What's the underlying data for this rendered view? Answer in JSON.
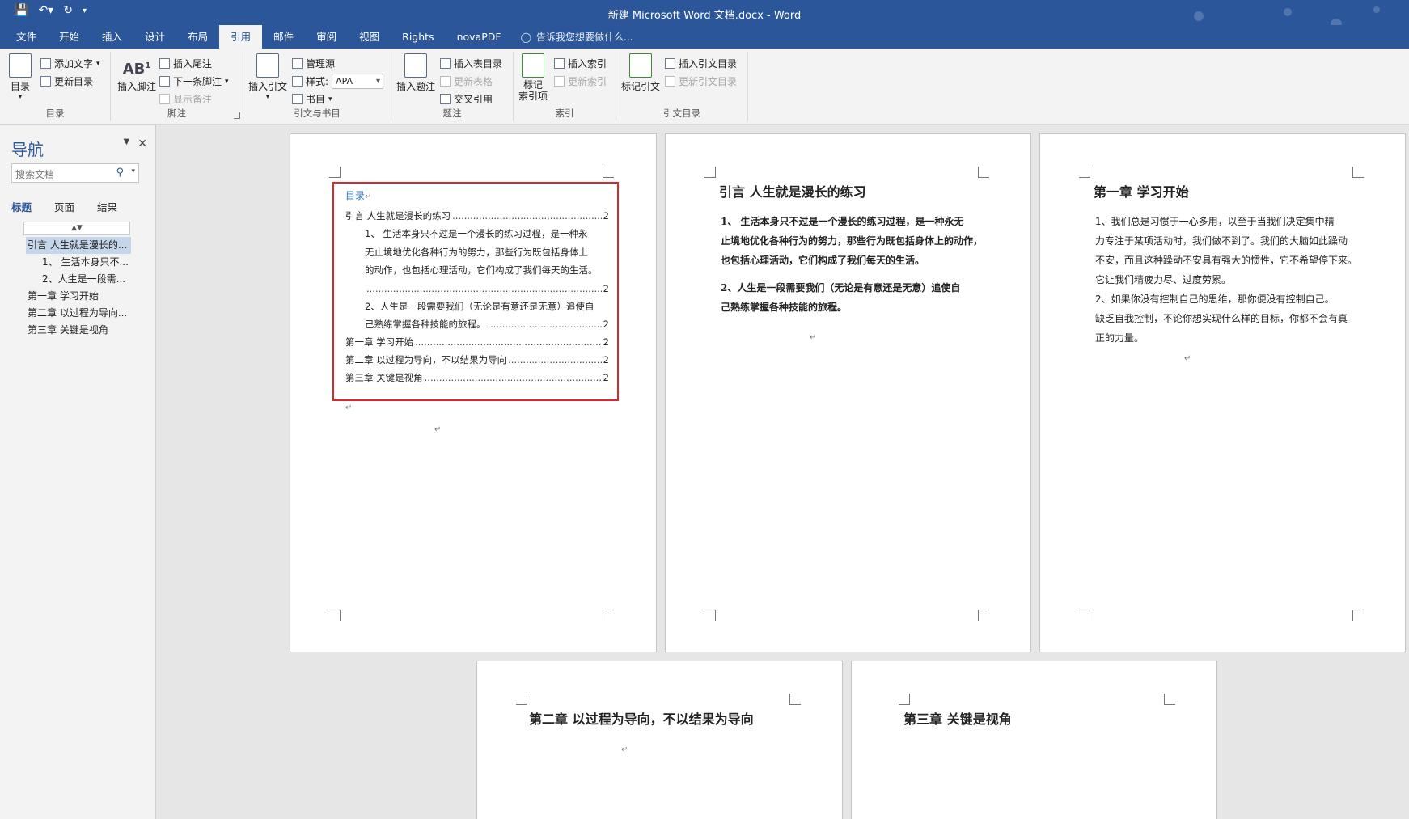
{
  "window": {
    "title": "新建 Microsoft Word 文档.docx - Word"
  },
  "tabs": [
    "文件",
    "开始",
    "插入",
    "设计",
    "布局",
    "引用",
    "邮件",
    "审阅",
    "视图",
    "Rights",
    "novaPDF"
  ],
  "active_tab": "引用",
  "tell_me": "告诉我您想要做什么...",
  "ribbon": {
    "toc_group": {
      "label": "目录",
      "toc_button": "目录",
      "add_text": "添加文字",
      "update_toc": "更新目录"
    },
    "footnote_group": {
      "label": "脚注",
      "insert_footnote": "插入脚注",
      "insert_endnote": "插入尾注",
      "next_footnote": "下一条脚注",
      "show_notes": "显示备注"
    },
    "citation_group": {
      "label": "引文与书目",
      "insert_citation": "插入引文",
      "manage_sources": "管理源",
      "style_label": "样式:",
      "style_value": "APA",
      "bibliography": "书目"
    },
    "caption_group": {
      "label": "题注",
      "insert_caption": "插入题注",
      "insert_table_of_figures": "插入表目录",
      "update_table": "更新表格",
      "cross_reference": "交叉引用"
    },
    "index_group": {
      "label": "索引",
      "mark_entry": "标记\n索引项",
      "insert_index": "插入索引",
      "update_index": "更新索引"
    },
    "authorities_group": {
      "label": "引文目录",
      "mark_citation": "标记引文",
      "insert_table_of_authorities": "插入引文目录",
      "update_table_of_authorities": "更新引文目录"
    }
  },
  "nav": {
    "title": "导航",
    "search_placeholder": "搜索文档",
    "tabs": [
      "标题",
      "页面",
      "结果"
    ],
    "items": [
      {
        "text": "引言 人生就是漫长的...",
        "level": 1,
        "selected": true
      },
      {
        "text": "1、 生活本身只不...",
        "level": 2
      },
      {
        "text": "2、人生是一段需...",
        "level": 2
      },
      {
        "text": "第一章 学习开始",
        "level": 1
      },
      {
        "text": "第二章 以过程为导向...",
        "level": 1
      },
      {
        "text": "第三章 关键是视角",
        "level": 1
      }
    ]
  },
  "page1": {
    "toc_heading": "目录",
    "lines": [
      {
        "label": "引言  人生就是漫长的练习",
        "page": "2"
      },
      {
        "para": [
          "1、  生活本身只不过是一个漫长的练习过程，是一种永",
          "无止境地优化各种行为的努力，那些行为既包括身体上",
          "的动作，也包括心理活动，它们构成了我们每天的生活。"
        ],
        "page": "2"
      },
      {
        "para": [
          "2、人生是一段需要我们（无论是有意还是无意）追使自",
          "己熟练掌握各种技能的旅程。"
        ],
        "page": "2"
      },
      {
        "label": "第一章  学习开始",
        "page": "2"
      },
      {
        "label": "第二章  以过程为导向，不以结果为导向",
        "page": "2"
      },
      {
        "label": "第三章  关键是视角",
        "page": "2"
      }
    ]
  },
  "page2": {
    "heading": "引言  人生就是漫长的练习",
    "p1": [
      "1、  生活本身只不过是一个漫长的练习过程，是一种永无",
      "止境地优化各种行为的努力，那些行为既包括身体上的动作，",
      "也包括心理活动，它们构成了我们每天的生活。"
    ],
    "p2": [
      "2、人生是一段需要我们（无论是有意还是无意）追使自",
      "己熟练掌握各种技能的旅程。"
    ]
  },
  "page3": {
    "heading": "第一章  学习开始",
    "p1": [
      "1、我们总是习惯于一心多用，以至于当我们决定集中精",
      "力专注于某项活动时，我们做不到了。我们的大脑如此躁动",
      "不安，而且这种躁动不安具有强大的惯性，它不希望停下来。",
      "它让我们精疲力尽、过度劳累。"
    ],
    "p2": [
      "2、如果你没有控制自己的思维，那你便没有控制自己。",
      "缺乏自我控制，不论你想实现什么样的目标，你都不会有真",
      "正的力量。"
    ]
  },
  "page4": {
    "heading": "第二章  以过程为导向，不以结果为导向"
  },
  "page5": {
    "heading": "第三章  关键是视角"
  },
  "colors": {
    "brand": "#2b579a",
    "highlight_box": "#e0262b",
    "toc_heading": "#2e74b5"
  }
}
